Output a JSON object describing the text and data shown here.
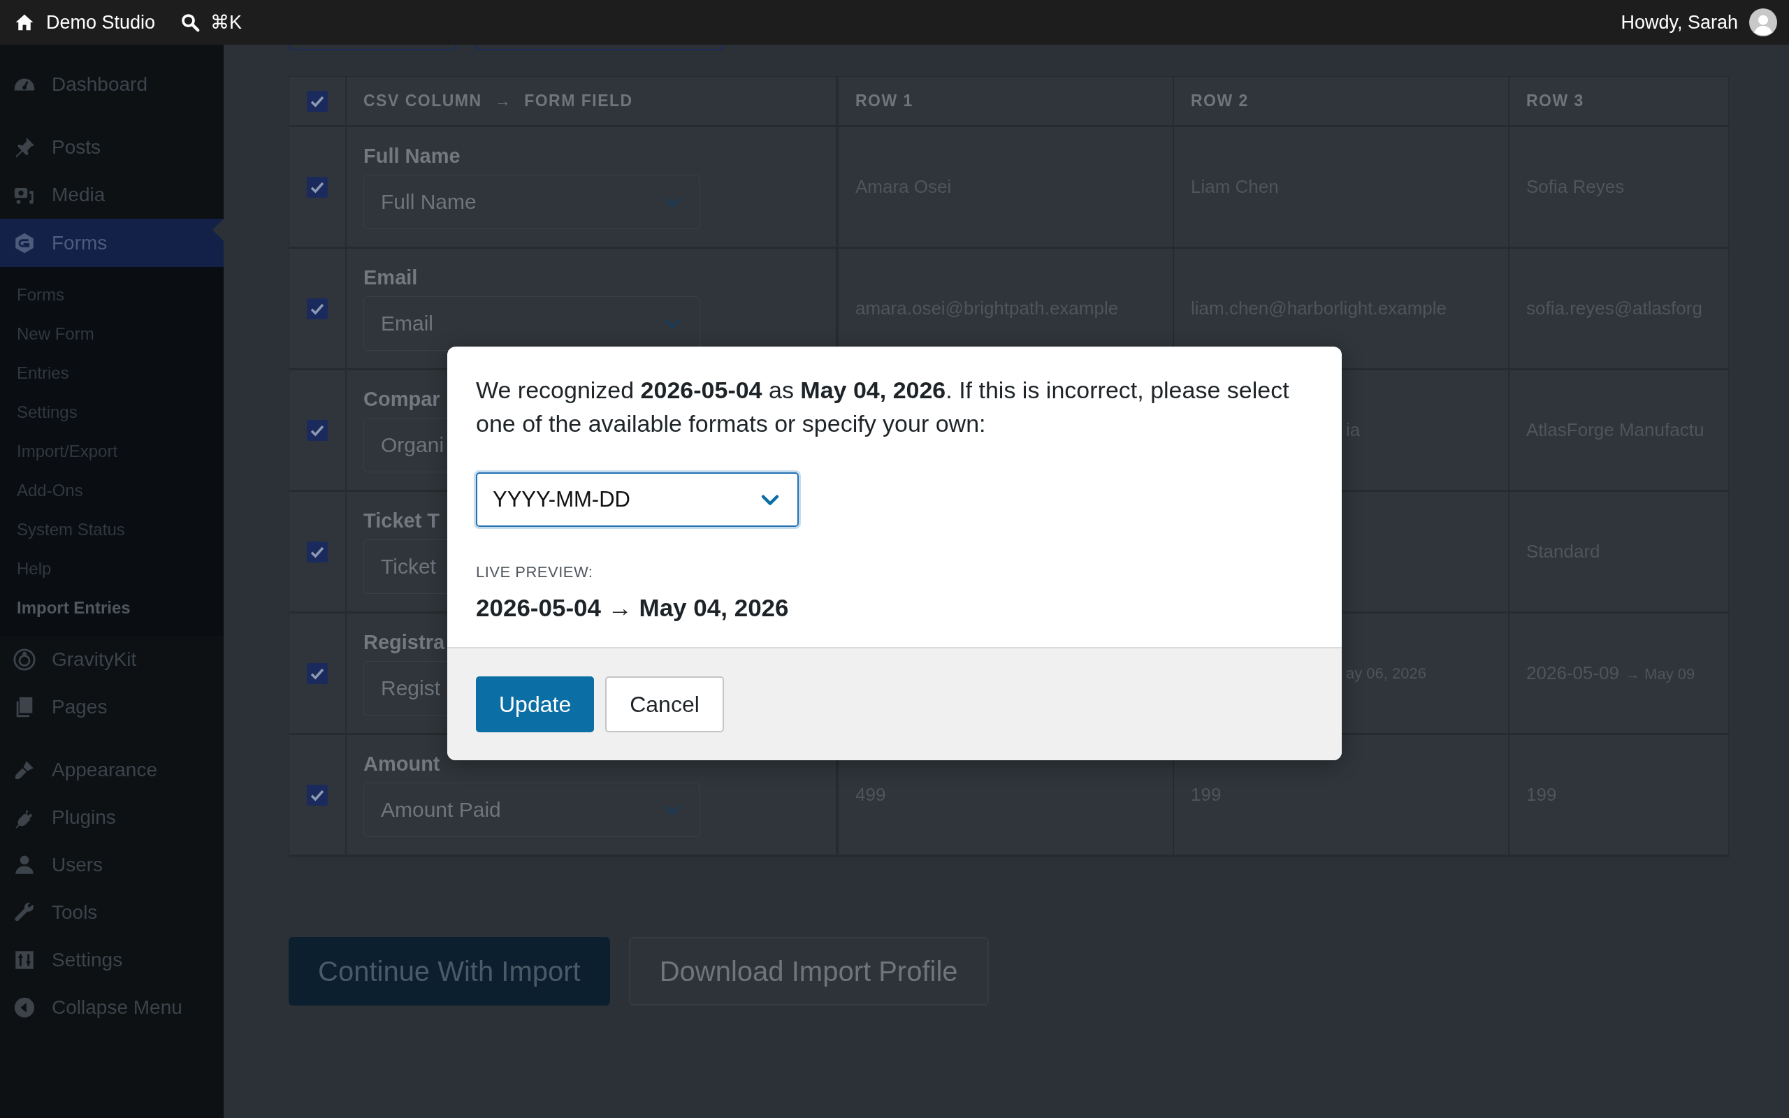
{
  "top_bar": {
    "site_name": "Demo Studio",
    "shortcut": "⌘K",
    "greeting": "Howdy, Sarah"
  },
  "sidebar": {
    "items": [
      {
        "label": "Dashboard",
        "selected": false
      },
      {
        "label": "Posts",
        "selected": false
      },
      {
        "label": "Media",
        "selected": false
      },
      {
        "label": "Forms",
        "selected": true,
        "children": [
          {
            "label": "Forms",
            "selected": false
          },
          {
            "label": "New Form",
            "selected": false
          },
          {
            "label": "Entries",
            "selected": false
          },
          {
            "label": "Settings",
            "selected": false
          },
          {
            "label": "Import/Export",
            "selected": false
          },
          {
            "label": "Add-Ons",
            "selected": false
          },
          {
            "label": "System Status",
            "selected": false
          },
          {
            "label": "Help",
            "selected": false
          },
          {
            "label": "Import Entries",
            "selected": true
          }
        ]
      },
      {
        "label": "GravityKit",
        "selected": false
      },
      {
        "label": "Pages",
        "selected": false
      },
      {
        "label": "Appearance",
        "selected": false
      },
      {
        "label": "Plugins",
        "selected": false
      },
      {
        "label": "Users",
        "selected": false
      },
      {
        "label": "Tools",
        "selected": false
      },
      {
        "label": "Settings",
        "selected": false
      },
      {
        "label": "Collapse Menu",
        "selected": false
      }
    ]
  },
  "table": {
    "all_checked": true,
    "csv_column": "CSV COLUMN",
    "arrow": "→",
    "form_field": "FORM FIELD",
    "columns": [
      "ROW 1",
      "ROW 2",
      "ROW 3"
    ],
    "rows": [
      {
        "checked": true,
        "label": "Full Name",
        "field": "Full Name",
        "cells": [
          {
            "text": "Amara Osei"
          },
          {
            "text": "Liam Chen"
          },
          {
            "text": "Sofia Reyes"
          }
        ]
      },
      {
        "checked": true,
        "label": "Email",
        "field": "Email",
        "cells": [
          {
            "text": "amara.osei@brightpath.example"
          },
          {
            "text": "liam.chen@harborlight.example"
          },
          {
            "text": "sofia.reyes@atlasforg"
          }
        ]
      },
      {
        "checked": true,
        "label": "Compar",
        "field": "Organi",
        "cells": [
          {},
          {
            "text": "ia"
          },
          {
            "text": "AtlasForge Manufactu"
          }
        ]
      },
      {
        "checked": true,
        "label": "Ticket T",
        "field": "Ticket",
        "cells": [
          {},
          {},
          {
            "text": "Standard"
          }
        ]
      },
      {
        "checked": true,
        "label": "Registra",
        "field": "Regist",
        "cells": [
          {},
          {
            "hint": "ay 06, 2026"
          },
          {
            "text": "2026-05-09",
            "hint": "→ May 09"
          }
        ]
      },
      {
        "checked": true,
        "label": "Amount",
        "field": "Amount Paid",
        "cells": [
          {
            "text": "499"
          },
          {
            "text": "199"
          },
          {
            "text": "199"
          }
        ]
      }
    ]
  },
  "actions": [
    {
      "label": "Continue With Import",
      "kind": "primary"
    },
    {
      "label": "Download Import Profile",
      "kind": "secondary"
    }
  ],
  "dialog": {
    "message": "We recognized **2026-05-04** as **May 04, 2026**. If this is incorrect, please select one of the available formats or specify your own:",
    "format": "YYYY-MM-DD",
    "preview_label": "LIVE PREVIEW:",
    "preview": "**2026-05-04** → **May 04, 2026**",
    "buttons": [
      {
        "label": "Update",
        "kind": "primary"
      },
      {
        "label": "Cancel",
        "kind": "secondary"
      }
    ]
  }
}
